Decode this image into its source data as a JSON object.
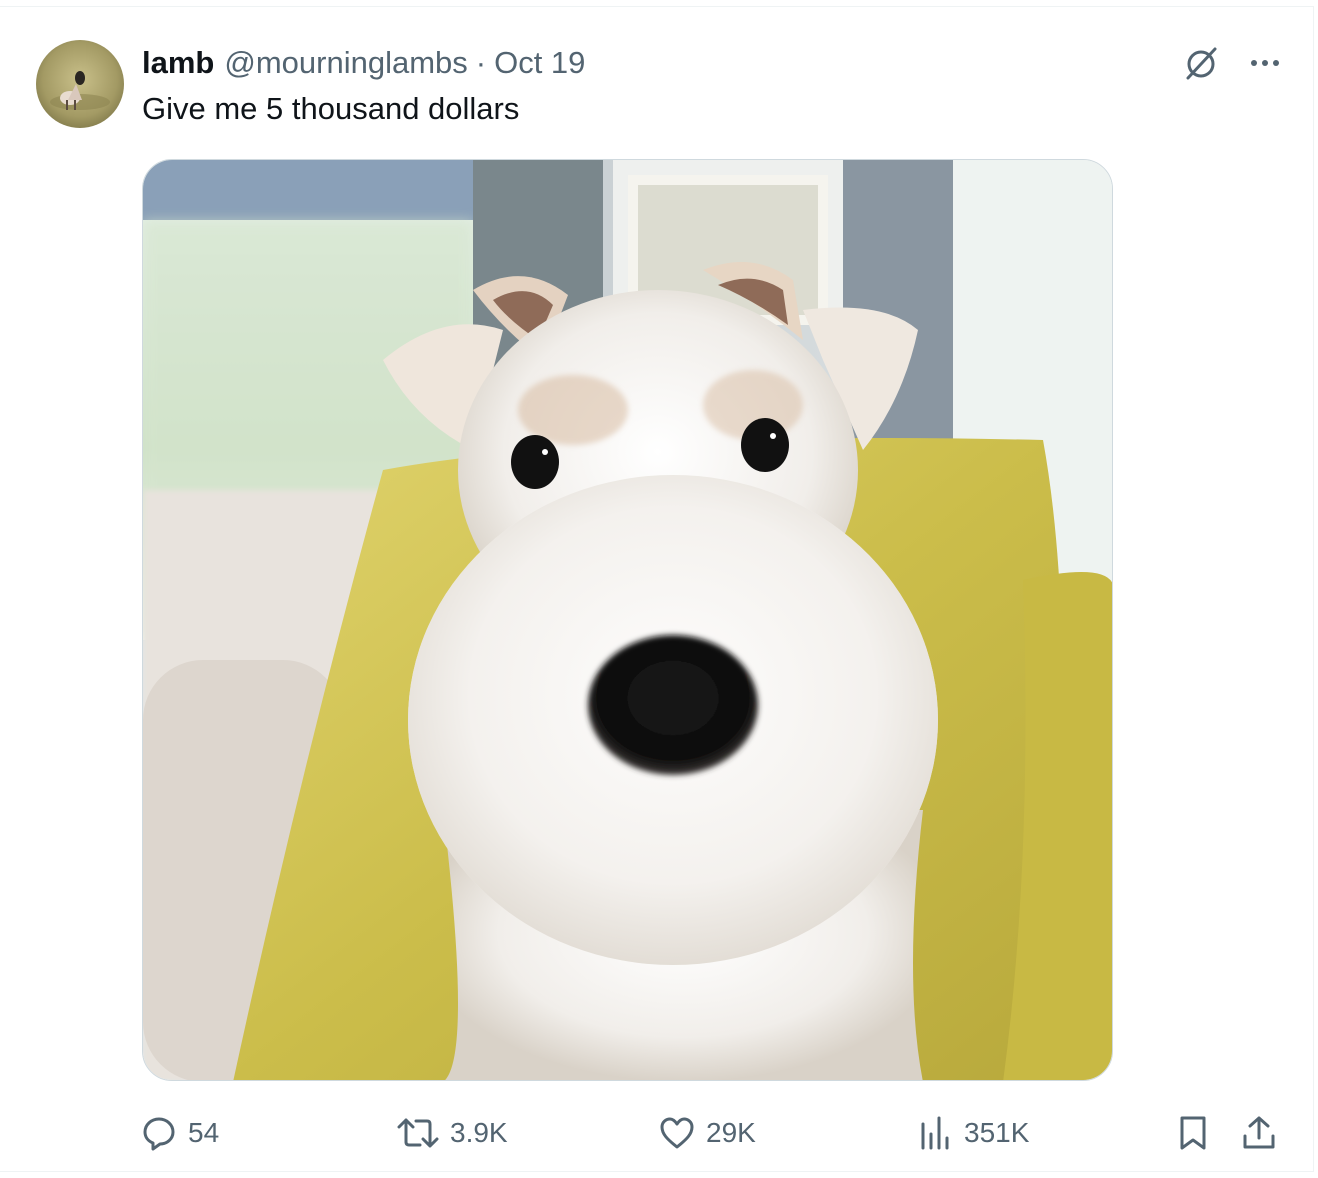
{
  "tweet": {
    "display_name": "lamb",
    "handle": "@mourninglambs",
    "separator": "·",
    "date": "Oct 19",
    "text": "Give me 5 thousand dollars"
  },
  "media": {
    "description_icon": "dog-photo"
  },
  "actions": {
    "replies": "54",
    "reposts": "3.9K",
    "likes": "29K",
    "views": "351K"
  },
  "icons": {
    "grok": "grok-slash-icon",
    "more": "more-dots-icon",
    "reply": "reply-bubble-icon",
    "repost": "repost-arrows-icon",
    "like": "heart-icon",
    "views": "bar-chart-icon",
    "bookmark": "bookmark-icon",
    "share": "share-upload-icon"
  },
  "colors": {
    "text_primary": "#0f1419",
    "text_secondary": "#536471",
    "border": "#cfd9de"
  }
}
